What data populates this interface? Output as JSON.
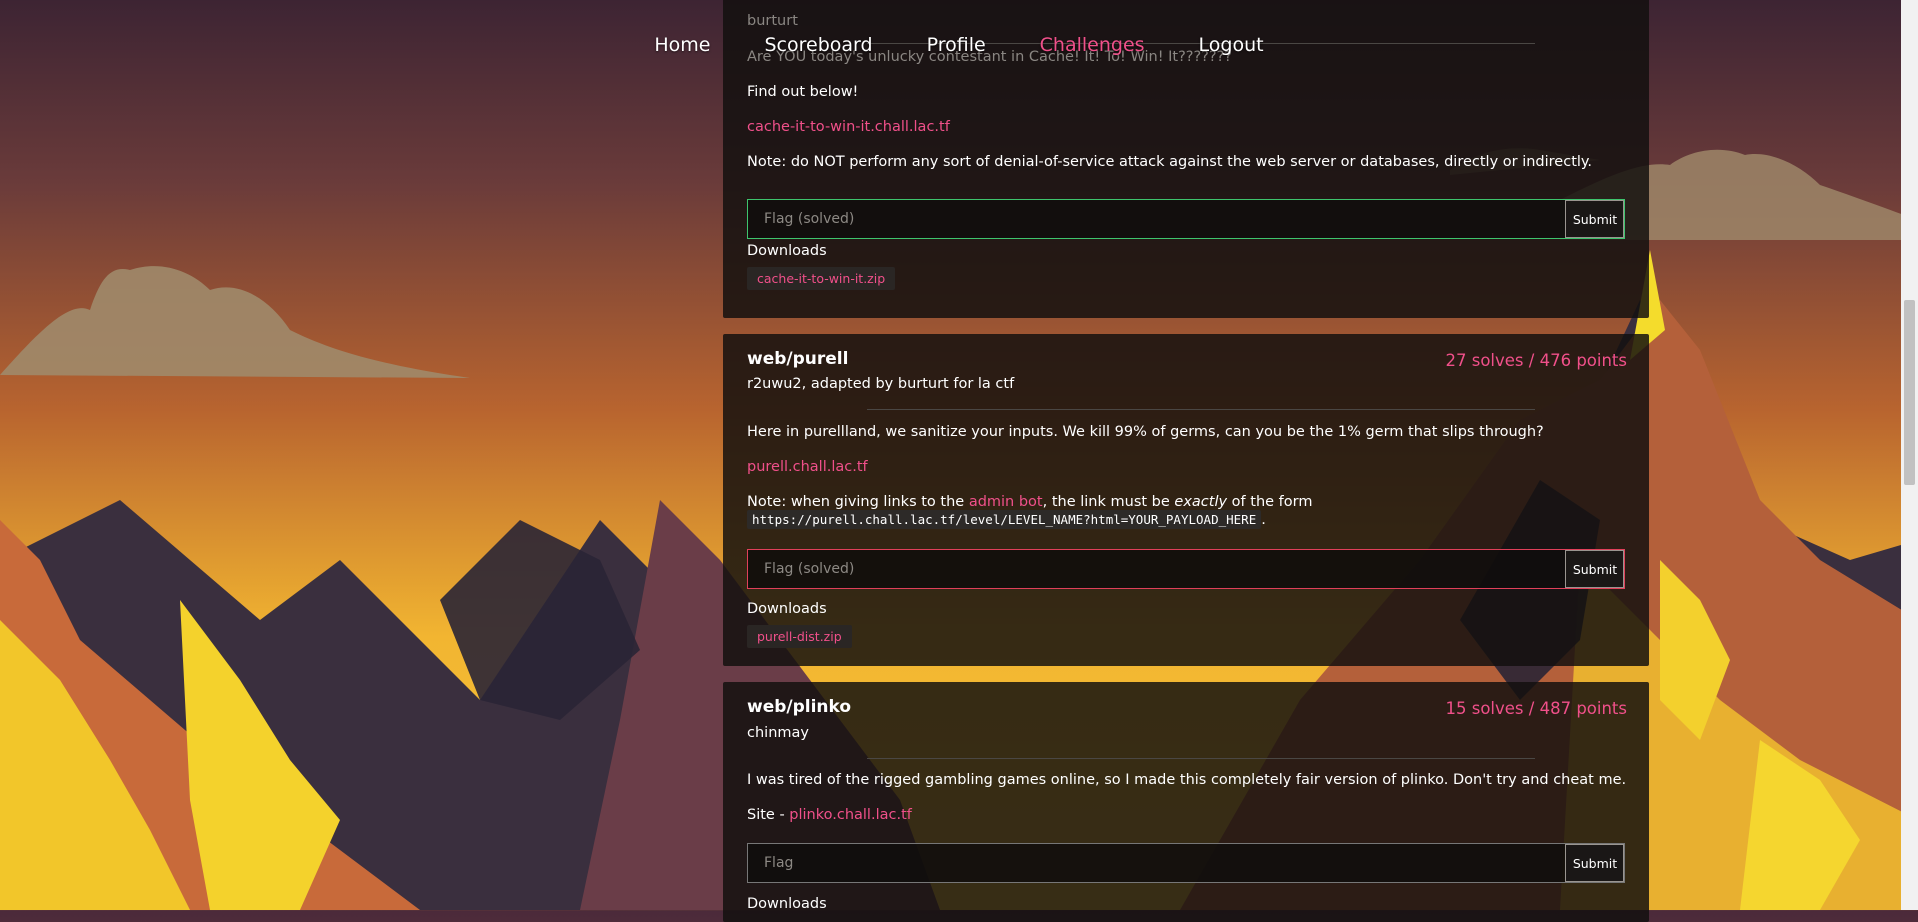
{
  "nav": {
    "items": [
      {
        "label": "Home",
        "active": false
      },
      {
        "label": "Scoreboard",
        "active": false
      },
      {
        "label": "Profile",
        "active": false
      },
      {
        "label": "Challenges",
        "active": true
      },
      {
        "label": "Logout",
        "active": false
      }
    ]
  },
  "cards": [
    {
      "author": "burturt",
      "description_partial": "Are YOU today's unlucky contestant in Cache! It! To! Win! It???????",
      "line2": "Find out below!",
      "link": "cache-it-to-win-it.chall.lac.tf",
      "note": "Note: do NOT perform any sort of denial-of-service attack against the web server or databases, directly or indirectly.",
      "flag_placeholder": "Flag (solved)",
      "submit_label": "Submit",
      "downloads_label": "Downloads",
      "download_file": "cache-it-to-win-it.zip",
      "status": "solved-correct"
    },
    {
      "title": "web/purell",
      "solves": "27 solves / 476 points",
      "author": "r2uwu2, adapted by burturt for la ctf",
      "description": "Here in purellland, we sanitize your inputs. We kill 99% of germs, can you be the 1% germ that slips through?",
      "link": "purell.chall.lac.tf",
      "note_prefix": "Note: when giving links to the ",
      "note_link": "admin bot",
      "note_middle": ", the link must be ",
      "note_em": "exactly",
      "note_suffix": " of the form",
      "note_code": "https://purell.chall.lac.tf/level/LEVEL_NAME?html=YOUR_PAYLOAD_HERE",
      "note_end": ".",
      "flag_placeholder": "Flag (solved)",
      "submit_label": "Submit",
      "downloads_label": "Downloads",
      "download_file": "purell-dist.zip",
      "status": "solved-error"
    },
    {
      "title": "web/plinko",
      "solves": "15 solves / 487 points",
      "author": "chinmay",
      "description": "I was tired of the rigged gambling games online, so I made this completely fair version of plinko. Don't try and cheat me.",
      "site_prefix": "Site - ",
      "link": "plinko.chall.lac.tf",
      "flag_placeholder": "Flag",
      "submit_label": "Submit",
      "downloads_label": "Downloads",
      "status": "unsolved"
    }
  ],
  "colors": {
    "accent": "#f0508a",
    "success_border": "#3ec46d",
    "error_border": "#e0405a"
  }
}
